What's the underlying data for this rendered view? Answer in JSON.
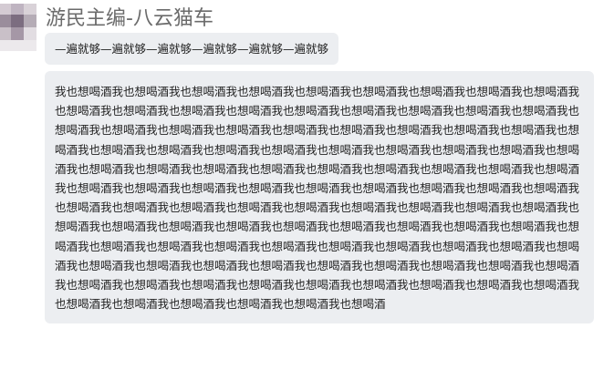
{
  "chat": {
    "sender_name": "游民主编-八云猫车",
    "messages": [
      {
        "text": "—遍就够—遍就够—遍就够—遍就够—遍就够—遍就够"
      },
      {
        "text": "我也想喝酒我也想喝酒我也想喝酒我也想喝酒我也想喝酒我也想喝酒我也想喝酒我也想喝酒我也想喝酒我也想喝酒我也想喝酒我也想喝酒我也想喝酒我也想喝酒我也想喝酒我也想喝酒我也想喝酒我也想喝酒我也想喝酒我也想喝酒我也想喝酒我也想喝酒我也想喝酒我也想喝酒我也想喝酒我也想喝酒我也想喝酒我也想喝酒我也想喝酒我也想喝酒我也想喝酒我也想喝酒我也想喝酒我也想喝酒我也想喝酒我也想喝酒我也想喝酒我也想喝酒我也想喝酒我也想喝酒我也想喝酒我也想喝酒我也想喝酒我也想喝酒我也想喝酒我也想喝酒我也想喝酒我也想喝酒我也想喝酒我也想喝酒我也想喝酒我也想喝酒我也想喝酒我也想喝酒我也想喝酒我也想喝酒我也想喝酒我也想喝酒我也想喝酒我也想喝酒我也想喝酒我也想喝酒我也想喝酒我也想喝酒我也想喝酒我也想喝酒我也想喝酒我也想喝酒我也想喝酒我也想喝酒我也想喝酒我也想喝酒我也想喝酒我也想喝酒我也想喝酒我也想喝酒我也想喝酒我也想喝酒我也想喝酒我也想喝酒我也想喝酒我也想喝酒我也想喝酒我也想喝酒我也想喝酒我也想喝酒我也想喝酒我也想喝酒我也想喝酒我也想喝酒我也想喝酒我也想喝酒我也想喝酒我也想喝酒我也想喝酒我也想喝酒我也想喝酒我也想喝酒我也想喝酒我也想喝酒我也想喝酒我也想喝酒我也想喝酒我也想喝酒我也想喝酒我也想喝酒我也想喝酒"
      }
    ]
  },
  "colors": {
    "bubble_background": "#eceef1",
    "message_text": "#222222",
    "sender_name_text": "#6b6b6b"
  }
}
